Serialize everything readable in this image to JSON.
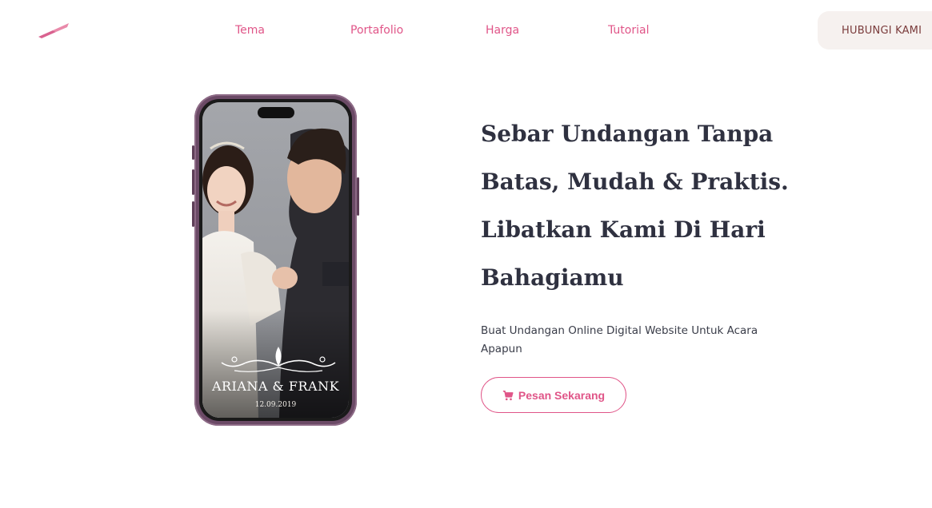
{
  "header": {
    "nav": [
      {
        "label": "Tema"
      },
      {
        "label": "Portafolio"
      },
      {
        "label": "Harga"
      },
      {
        "label": "Tutorial"
      }
    ],
    "contact_label": "HUBUNGI KAMI"
  },
  "hero": {
    "title": "Sebar Undangan Tanpa Batas, Mudah & Praktis. Libatkan Kami Di Hari Bahagiamu",
    "subtitle": "Buat Undangan Online Digital Website Untuk Acara Apapun",
    "cta_label": "Pesan Sekarang",
    "cta_icon": "cart-icon"
  },
  "phone_preview": {
    "couple_name": "ARIANA & FRANK",
    "date": "12.09.2019"
  },
  "colors": {
    "accent": "#e05588",
    "heading": "#2f3140",
    "contact_bg": "#f6f1ef",
    "contact_text": "#7a3b3b"
  }
}
